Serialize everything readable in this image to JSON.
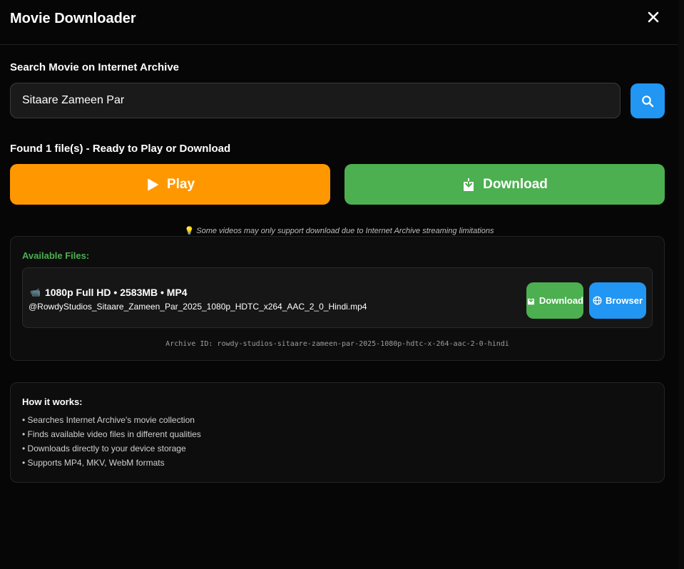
{
  "header": {
    "title": "Movie Downloader"
  },
  "search": {
    "label": "Search Movie on Internet Archive",
    "value": "Sitaare Zameen Par"
  },
  "results": {
    "found_label": "Found 1 file(s) - Ready to Play or Download",
    "play_label": "Play",
    "download_label": "Download",
    "note": "Some videos may only support download due to Internet Archive streaming limitations"
  },
  "files": {
    "title": "Available Files:",
    "items": [
      {
        "quality": "1080p Full HD • 2583MB • MP4",
        "filename": "@RowdyStudios_Sitaare_Zameen_Par_2025_1080p_HDTC_x264_AAC_2_0_Hindi.mp4",
        "download_label": "Download",
        "browser_label": "Browser"
      }
    ],
    "archive_id": "Archive ID: rowdy-studios-sitaare-zameen-par-2025-1080p-hdtc-x-264-aac-2-0-hindi"
  },
  "how_it_works": {
    "title": "How it works:",
    "items": [
      "• Searches Internet Archive's movie collection",
      "• Finds available video files in different qualities",
      "• Downloads directly to your device storage",
      "• Supports MP4, MKV, WebM formats"
    ]
  },
  "colors": {
    "play": "#ff9800",
    "download": "#4caf50",
    "search": "#2196f3",
    "browser": "#2196f3",
    "files_title": "#4caf50",
    "background": "#060606"
  },
  "icons": {
    "close": "close-icon",
    "search": "search-icon",
    "play": "play-icon",
    "download": "download-icon",
    "lightbulb": "lightbulb-icon",
    "video_camera": "video-camera-icon",
    "globe": "globe-icon"
  }
}
